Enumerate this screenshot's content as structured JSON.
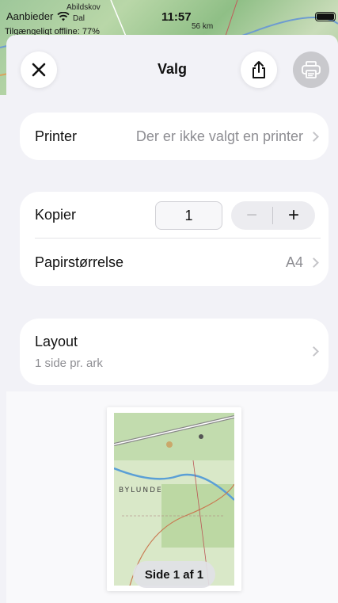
{
  "status": {
    "carrier": "Aanbieder",
    "time": "11:57",
    "offline": "Tilgængeligt offline: 77%",
    "map_labels": [
      "Abildskov",
      "Dal",
      "56 km"
    ]
  },
  "nav": {
    "title": "Valg"
  },
  "printer": {
    "label": "Printer",
    "value": "Der er ikke valgt en printer"
  },
  "copies": {
    "label": "Kopier",
    "value": "1",
    "minus": "−",
    "plus": "+"
  },
  "paper": {
    "label": "Papirstørrelse",
    "value": "A4"
  },
  "layout": {
    "label": "Layout",
    "sub": "1 side pr. ark"
  },
  "preview": {
    "page_label": "Side 1 af 1",
    "map_text": "BYLUNDE"
  },
  "colors": {
    "accent": "#111111",
    "background": "#f2f2f7",
    "card": "#ffffff",
    "secondary_text": "#8e8e93"
  },
  "icons": [
    "wifi-icon",
    "battery-icon",
    "close-icon",
    "share-icon",
    "printer-icon",
    "chevron-right-icon"
  ]
}
